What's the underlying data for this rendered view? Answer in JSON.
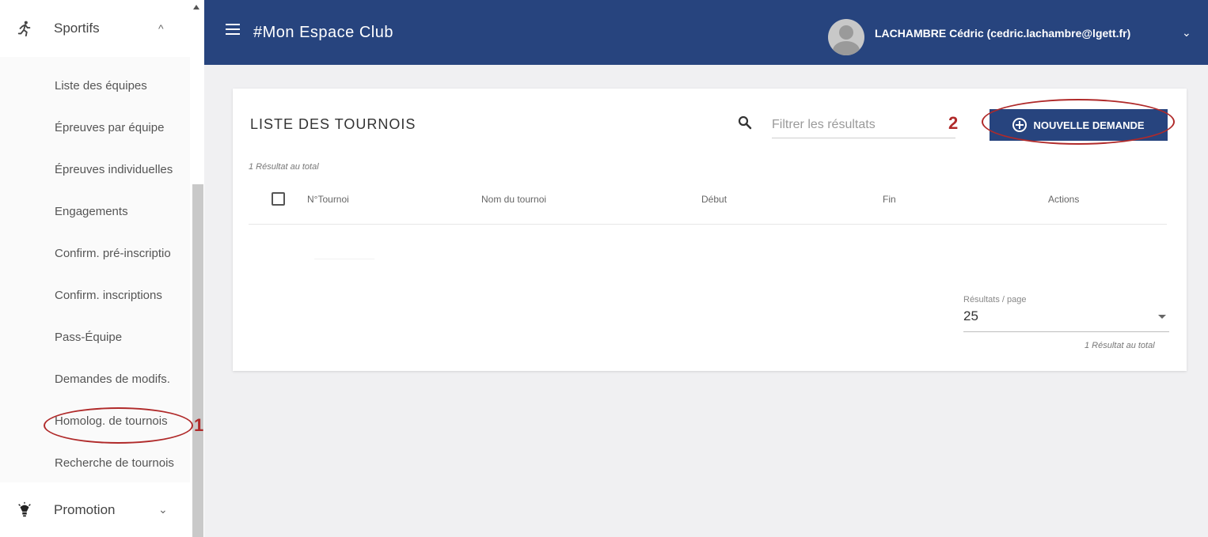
{
  "sidebar": {
    "sportifs": {
      "label": "Sportifs",
      "icon": "runner-icon",
      "chevron": "^"
    },
    "items": [
      {
        "label": "Liste des équipes"
      },
      {
        "label": "Épreuves par équipe"
      },
      {
        "label": "Épreuves individuelles"
      },
      {
        "label": "Engagements"
      },
      {
        "label": "Confirm. pré-inscriptio"
      },
      {
        "label": "Confirm. inscriptions"
      },
      {
        "label": "Pass-Équipe"
      },
      {
        "label": "Demandes de modifs."
      },
      {
        "label": "Homolog. de tournois"
      },
      {
        "label": "Recherche de tournois"
      }
    ],
    "promotion": {
      "label": "Promotion",
      "icon": "lightbulb-icon",
      "chevron": "⌄"
    }
  },
  "header": {
    "title": "#Mon Espace Club",
    "user": "LACHAMBRE Cédric (cedric.lachambre@lgett.fr)",
    "user_chevron": "⌄"
  },
  "annotations": {
    "one": "1",
    "two": "2",
    "color": "#b02a2a"
  },
  "main": {
    "title": "LISTE DES TOURNOIS",
    "search": {
      "placeholder": "Filtrer les résultats"
    },
    "new_button": "NOUVELLE DEMANDE",
    "count_top": "1 Résultat au total",
    "columns": [
      "N°Tournoi",
      "Nom du tournoi",
      "Début",
      "Fin",
      "Actions"
    ],
    "per_page": {
      "label": "Résultats / page",
      "value": "25"
    },
    "count_bottom": "1 Résultat au total"
  },
  "colors": {
    "primary": "#27447e",
    "background": "#f0f0f2"
  }
}
